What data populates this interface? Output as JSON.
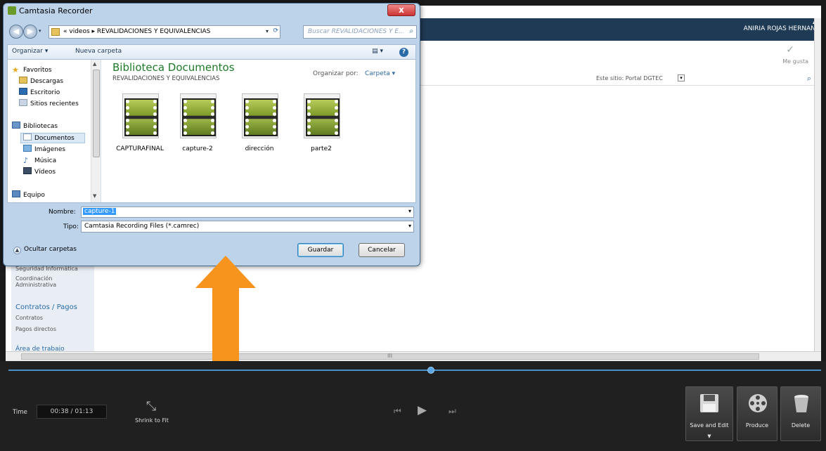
{
  "background_page": {
    "user_name": "ANIRIA ROJAS HERNAN",
    "like_label": "Me gusta",
    "search_scope": "Este sitio: Portal DGTEC",
    "left_nav": {
      "partial_item": "Seguridad Informática",
      "coordination": "Coordinación Administrativa",
      "section_heading": "Contratos / Pagos",
      "items": [
        "Contratos",
        "Pagos directos"
      ],
      "partial_bottom": "Área de trabajo"
    },
    "hscroll_grip": "III"
  },
  "dialog": {
    "title": "Camtasia Recorder",
    "close_label": "x",
    "address_path": "« videos ▸ REVALIDACIONES Y EQUIVALENCIAS",
    "search_placeholder": "Buscar REVALIDACIONES Y E...",
    "toolbar": {
      "organize": "Organizar ▾",
      "new_folder": "Nueva carpeta",
      "view": "▤ ▾",
      "help": "?"
    },
    "nav": {
      "favorites": "Favoritos",
      "downloads": "Descargas",
      "desktop": "Escritorio",
      "recent": "Sitios recientes",
      "libraries": "Bibliotecas",
      "documents": "Documentos",
      "images": "Imágenes",
      "music": "Música",
      "videos": "Vídeos",
      "computer": "Equipo"
    },
    "library_title": "Biblioteca Documentos",
    "library_subtitle": "REVALIDACIONES Y EQUIVALENCIAS",
    "arrange_label": "Organizar por:",
    "arrange_value": "Carpeta ▾",
    "files": [
      {
        "name": "CAPTURAFINAL"
      },
      {
        "name": "capture-2"
      },
      {
        "name": "dirección"
      },
      {
        "name": "parte2"
      }
    ],
    "filename_label": "Nombre:",
    "filename_value": "capture-1",
    "filetype_label": "Tipo:",
    "filetype_value": "Camtasia Recording Files (*.camrec)",
    "hide_folders": "Ocultar carpetas",
    "save_label": "Guardar",
    "cancel_label": "Cancelar"
  },
  "player": {
    "progress": 0.52,
    "time_label": "Time",
    "time_value": "00:38 / 01:13",
    "shrink_label": "Shrink to Fit",
    "save_edit_label": "Save and Edit",
    "produce_label": "Produce",
    "delete_label": "Delete"
  },
  "colors": {
    "annotation_arrow": "#f7941d",
    "library_title": "#1d7a28",
    "topbar": "#1f3a55"
  }
}
